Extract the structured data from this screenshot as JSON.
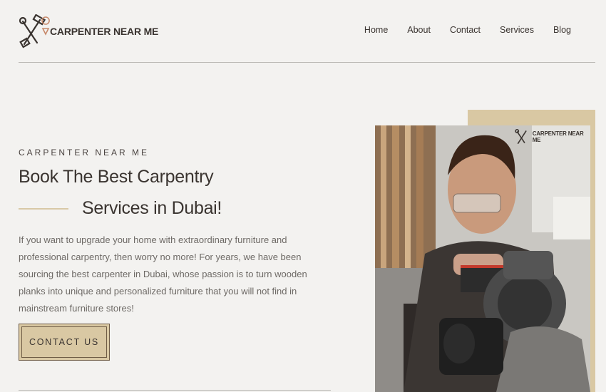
{
  "brand": {
    "name": "CARPENTER NEAR ME"
  },
  "nav": {
    "items": [
      {
        "label": "Home"
      },
      {
        "label": "About"
      },
      {
        "label": "Contact"
      },
      {
        "label": "Services"
      },
      {
        "label": "Blog"
      }
    ]
  },
  "hero": {
    "eyebrow": "CARPENTER NEAR ME",
    "headline_line1": "Book The Best Carpentry",
    "headline_line2": "Services in Dubai!",
    "description": "If you want to upgrade your home with extraordinary furniture and professional carpentry, then worry no more! For years, we have been sourcing the best carpenter in Dubai, whose passion is to turn wooden planks into unique and personalized furniture that you will not find in mainstream furniture stores!",
    "cta_label": "CONTACT US"
  },
  "photo": {
    "watermark": "CARPENTER NEAR ME"
  },
  "colors": {
    "background": "#f3f2f0",
    "accent": "#d9c8a3",
    "text": "#3a3430",
    "body_text": "#6e6a66"
  }
}
